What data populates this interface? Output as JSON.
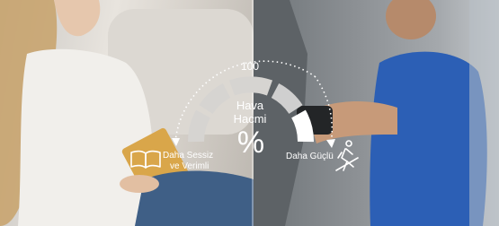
{
  "scale": {
    "max_value": "100",
    "title_line1": "Hava",
    "title_line2": "Hacmi",
    "unit": "%"
  },
  "left_label": {
    "line1": "Daha Sessiz",
    "line2": "ve Verimli",
    "icon": "open-book-icon"
  },
  "right_label": {
    "line1": "Daha Güçlü",
    "icon": "running-person-icon"
  },
  "gauge": {
    "segments": 5,
    "active_segment_color": "#ffffff",
    "inactive_segment_color": "#cfcfcf"
  }
}
